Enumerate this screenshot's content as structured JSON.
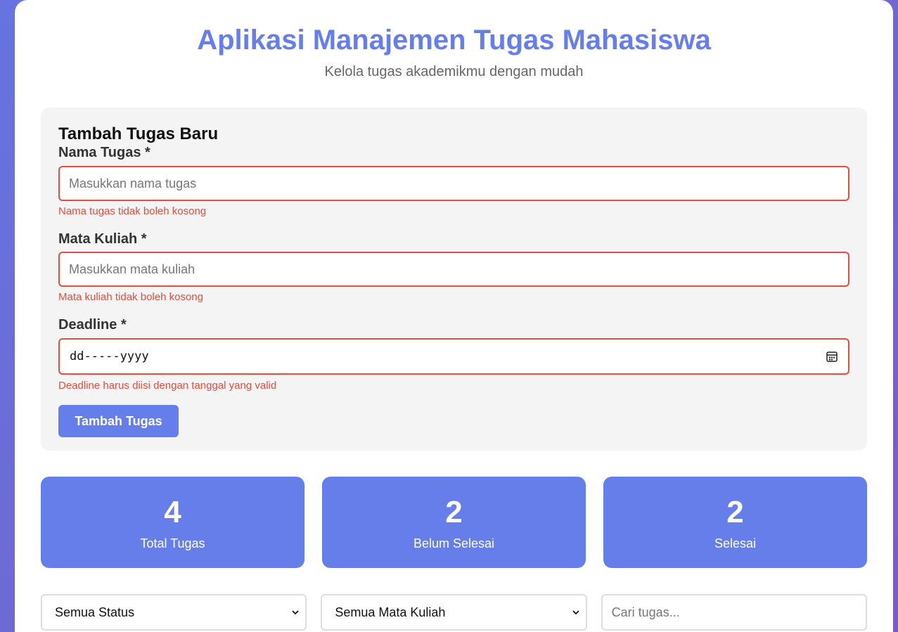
{
  "header": {
    "title": "Aplikasi Manajemen Tugas Mahasiswa",
    "subtitle": "Kelola tugas akademikmu dengan mudah"
  },
  "form": {
    "title": "Tambah Tugas Baru",
    "task_name": {
      "label": "Nama Tugas *",
      "placeholder": "Masukkan nama tugas",
      "value": "",
      "error": "Nama tugas tidak boleh kosong"
    },
    "course": {
      "label": "Mata Kuliah *",
      "placeholder": "Masukkan mata kuliah",
      "value": "",
      "error": "Mata kuliah tidak boleh kosong"
    },
    "deadline": {
      "label": "Deadline *",
      "display": "dd-----yyyy",
      "error": "Deadline harus diisi dengan tanggal yang valid"
    },
    "submit_label": "Tambah Tugas"
  },
  "stats": [
    {
      "value": "4",
      "label": "Total Tugas"
    },
    {
      "value": "2",
      "label": "Belum Selesai"
    },
    {
      "value": "2",
      "label": "Selesai"
    }
  ],
  "filters": {
    "status_selected": "Semua Status",
    "course_selected": "Semua Mata Kuliah",
    "search_placeholder": "Cari tugas..."
  },
  "colors": {
    "accent": "#667eea",
    "error": "#e74c3c",
    "background_gradient_start": "#6673e0",
    "background_gradient_end": "#7a5cc4"
  },
  "icons": {
    "deadline": "calendar-icon",
    "select": "chevron-down-icon"
  }
}
